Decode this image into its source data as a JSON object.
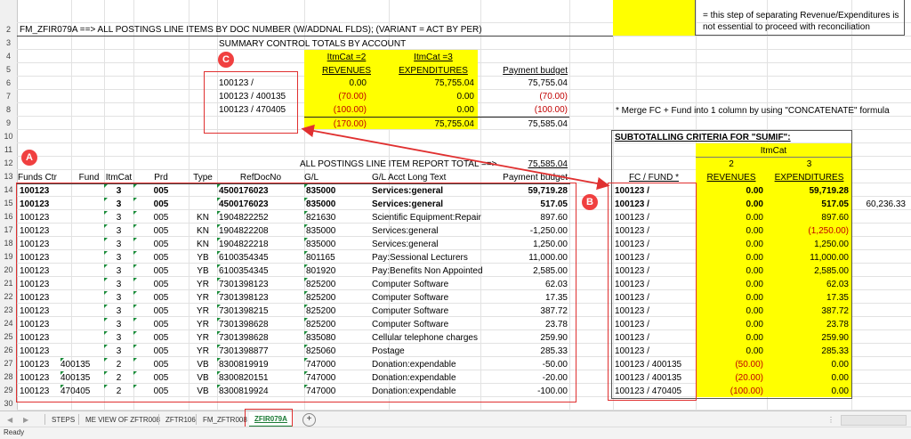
{
  "app": {
    "sheet_title": "FM_ZFIR079A ==>  ALL POSTINGS LINE ITEMS BY DOC NUMBER (W/ADDNAL FLDS); (VARIANT = ACT BY PER)",
    "legend_note_line1": "= this step of separating Revenue/Expenditures is",
    "legend_note_line2": "not essential to proceed with reconciliation",
    "summary_heading": "SUMMARY CONTROL TOTALS BY ACCOUNT",
    "merge_note": "* Merge FC + Fund into 1 column by using \"CONCATENATE\" formula",
    "subtotal_heading": "SUBTOTALLING CRITERIA FOR \"SUMIF\":",
    "report_total_label": "ALL POSTINGS LINE ITEM REPORT TOTAL ==>",
    "report_total_value": "75,585.04",
    "side_total": "60,236.33",
    "status": "Ready"
  },
  "row_numbers": [
    "2",
    "3",
    "4",
    "5",
    "6",
    "7",
    "8",
    "9",
    "10",
    "11",
    "12",
    "13",
    "14",
    "15",
    "16",
    "17",
    "18",
    "19",
    "20",
    "21",
    "22",
    "23",
    "24",
    "25",
    "26",
    "27",
    "28",
    "29",
    "30"
  ],
  "summary": {
    "hdr_itmcat2": "ItmCat =2",
    "hdr_itmcat3": "ItmCat =3",
    "hdr_revenues": "REVENUES",
    "hdr_expenditures": "EXPENDITURES",
    "hdr_payment": "Payment budget",
    "rows": [
      {
        "acct": "100123 /",
        "rev": "0.00",
        "exp": "75,755.04",
        "pay": "75,755.04"
      },
      {
        "acct": "100123 / 400135",
        "rev": "(70.00)",
        "exp": "0.00",
        "pay": "(70.00)"
      },
      {
        "acct": "100123 / 470405",
        "rev": "(100.00)",
        "exp": "0.00",
        "pay": "(100.00)"
      }
    ],
    "total": {
      "rev": "(170.00)",
      "exp": "75,755.04",
      "pay": "75,585.04"
    }
  },
  "main_table": {
    "headers": [
      "Funds Ctr",
      "Fund",
      "ItmCat",
      "Prd",
      "Type",
      "RefDocNo",
      "G/L",
      "G/L Acct Long Text",
      "Payment budget"
    ],
    "rows": [
      {
        "fc": "100123",
        "fund": "",
        "itm": "3",
        "prd": "005",
        "type": "",
        "ref": "4500176023",
        "gl": "835000",
        "text": "Services:general",
        "pay": "59,719.28",
        "bold": true
      },
      {
        "fc": "100123",
        "fund": "",
        "itm": "3",
        "prd": "005",
        "type": "",
        "ref": "4500176023",
        "gl": "835000",
        "text": "Services:general",
        "pay": "517.05",
        "bold": true
      },
      {
        "fc": "100123",
        "fund": "",
        "itm": "3",
        "prd": "005",
        "type": "KN",
        "ref": "1904822252",
        "gl": "821630",
        "text": "Scientific Equipment:Repair",
        "pay": "897.60",
        "bold": false
      },
      {
        "fc": "100123",
        "fund": "",
        "itm": "3",
        "prd": "005",
        "type": "KN",
        "ref": "1904822208",
        "gl": "835000",
        "text": "Services:general",
        "pay": "-1,250.00",
        "bold": false
      },
      {
        "fc": "100123",
        "fund": "",
        "itm": "3",
        "prd": "005",
        "type": "KN",
        "ref": "1904822218",
        "gl": "835000",
        "text": "Services:general",
        "pay": "1,250.00",
        "bold": false
      },
      {
        "fc": "100123",
        "fund": "",
        "itm": "3",
        "prd": "005",
        "type": "YB",
        "ref": "6100354345",
        "gl": "801165",
        "text": "Pay:Sessional Lecturers",
        "pay": "11,000.00",
        "bold": false
      },
      {
        "fc": "100123",
        "fund": "",
        "itm": "3",
        "prd": "005",
        "type": "YB",
        "ref": "6100354345",
        "gl": "801920",
        "text": "Pay:Benefits Non Appointed",
        "pay": "2,585.00",
        "bold": false
      },
      {
        "fc": "100123",
        "fund": "",
        "itm": "3",
        "prd": "005",
        "type": "YR",
        "ref": "7301398123",
        "gl": "825200",
        "text": "Computer Software",
        "pay": "62.03",
        "bold": false
      },
      {
        "fc": "100123",
        "fund": "",
        "itm": "3",
        "prd": "005",
        "type": "YR",
        "ref": "7301398123",
        "gl": "825200",
        "text": "Computer Software",
        "pay": "17.35",
        "bold": false
      },
      {
        "fc": "100123",
        "fund": "",
        "itm": "3",
        "prd": "005",
        "type": "YR",
        "ref": "7301398215",
        "gl": "825200",
        "text": "Computer Software",
        "pay": "387.72",
        "bold": false
      },
      {
        "fc": "100123",
        "fund": "",
        "itm": "3",
        "prd": "005",
        "type": "YR",
        "ref": "7301398628",
        "gl": "825200",
        "text": "Computer Software",
        "pay": "23.78",
        "bold": false
      },
      {
        "fc": "100123",
        "fund": "",
        "itm": "3",
        "prd": "005",
        "type": "YR",
        "ref": "7301398628",
        "gl": "835080",
        "text": "Cellular telephone charges",
        "pay": "259.90",
        "bold": false
      },
      {
        "fc": "100123",
        "fund": "",
        "itm": "3",
        "prd": "005",
        "type": "YR",
        "ref": "7301398877",
        "gl": "825060",
        "text": "Postage",
        "pay": "285.33",
        "bold": false
      },
      {
        "fc": "100123",
        "fund": "400135",
        "itm": "2",
        "prd": "005",
        "type": "VB",
        "ref": "8300819919",
        "gl": "747000",
        "text": "Donation:expendable",
        "pay": "-50.00",
        "bold": false
      },
      {
        "fc": "100123",
        "fund": "400135",
        "itm": "2",
        "prd": "005",
        "type": "VB",
        "ref": "8300820151",
        "gl": "747000",
        "text": "Donation:expendable",
        "pay": "-20.00",
        "bold": false
      },
      {
        "fc": "100123",
        "fund": "470405",
        "itm": "2",
        "prd": "005",
        "type": "VB",
        "ref": "8300819924",
        "gl": "747000",
        "text": "Donation:expendable",
        "pay": "-100.00",
        "bold": false
      }
    ]
  },
  "subtotal": {
    "hdr_itmcat": "ItmCat",
    "hdr_2": "2",
    "hdr_3": "3",
    "hdr_fcfund": "FC / FUND *",
    "hdr_revenues": "REVENUES",
    "hdr_expenditures": "EXPENDITURES",
    "rows": [
      {
        "key": "100123 /",
        "rev": "0.00",
        "exp": "59,719.28",
        "exp_red": false,
        "rev_red": false,
        "bold": true
      },
      {
        "key": "100123 /",
        "rev": "0.00",
        "exp": "517.05",
        "exp_red": false,
        "rev_red": false,
        "bold": true
      },
      {
        "key": "100123 /",
        "rev": "0.00",
        "exp": "897.60",
        "exp_red": false,
        "rev_red": false,
        "bold": false
      },
      {
        "key": "100123 /",
        "rev": "0.00",
        "exp": "(1,250.00)",
        "exp_red": true,
        "rev_red": false,
        "bold": false
      },
      {
        "key": "100123 /",
        "rev": "0.00",
        "exp": "1,250.00",
        "exp_red": false,
        "rev_red": false,
        "bold": false
      },
      {
        "key": "100123 /",
        "rev": "0.00",
        "exp": "11,000.00",
        "exp_red": false,
        "rev_red": false,
        "bold": false
      },
      {
        "key": "100123 /",
        "rev": "0.00",
        "exp": "2,585.00",
        "exp_red": false,
        "rev_red": false,
        "bold": false
      },
      {
        "key": "100123 /",
        "rev": "0.00",
        "exp": "62.03",
        "exp_red": false,
        "rev_red": false,
        "bold": false
      },
      {
        "key": "100123 /",
        "rev": "0.00",
        "exp": "17.35",
        "exp_red": false,
        "rev_red": false,
        "bold": false
      },
      {
        "key": "100123 /",
        "rev": "0.00",
        "exp": "387.72",
        "exp_red": false,
        "rev_red": false,
        "bold": false
      },
      {
        "key": "100123 /",
        "rev": "0.00",
        "exp": "23.78",
        "exp_red": false,
        "rev_red": false,
        "bold": false
      },
      {
        "key": "100123 /",
        "rev": "0.00",
        "exp": "259.90",
        "exp_red": false,
        "rev_red": false,
        "bold": false
      },
      {
        "key": "100123 /",
        "rev": "0.00",
        "exp": "285.33",
        "exp_red": false,
        "rev_red": false,
        "bold": false
      },
      {
        "key": "100123 / 400135",
        "rev": "(50.00)",
        "exp": "0.00",
        "exp_red": false,
        "rev_red": true,
        "bold": false
      },
      {
        "key": "100123 / 400135",
        "rev": "(20.00)",
        "exp": "0.00",
        "exp_red": false,
        "rev_red": true,
        "bold": false
      },
      {
        "key": "100123 / 470405",
        "rev": "(100.00)",
        "exp": "0.00",
        "exp_red": false,
        "rev_red": true,
        "bold": false
      }
    ]
  },
  "callouts": {
    "a": "A",
    "b": "B",
    "c": "C"
  },
  "tabs": {
    "items": [
      {
        "label": "STEPS",
        "active": false
      },
      {
        "label": "ME VIEW OF ZFTR008",
        "active": false
      },
      {
        "label": "ZFTR106",
        "active": false
      },
      {
        "label": "FM_ZFTR008",
        "active": false
      },
      {
        "label": "ZFIR079A",
        "active": true
      }
    ],
    "add_symbol": "+"
  },
  "colors": {
    "highlight": "#ffff00",
    "negative": "#c00000",
    "callout": "#f04040",
    "active_tab": "#1a7a34"
  }
}
